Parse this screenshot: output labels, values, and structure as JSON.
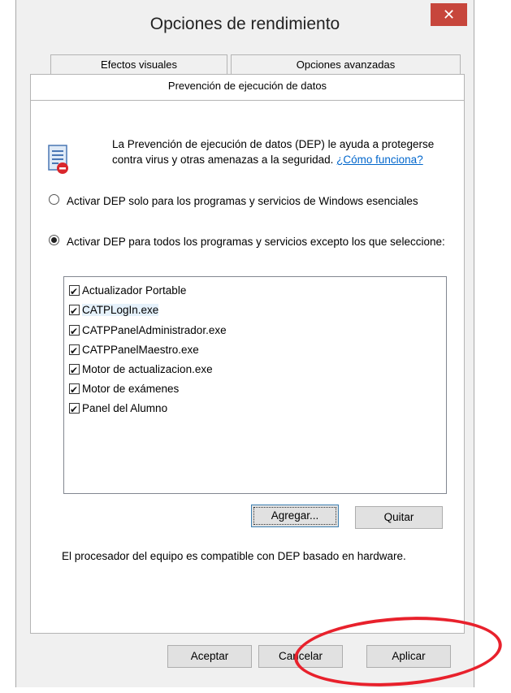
{
  "window": {
    "title": "Opciones de rendimiento",
    "close_symbol": "✕"
  },
  "tabs": [
    {
      "label": "Efectos visuales"
    },
    {
      "label": "Opciones avanzadas"
    },
    {
      "label": "Prevención de ejecución de datos"
    }
  ],
  "intro": {
    "text": "La Prevención de ejecución de datos (DEP) le ayuda a protegerse contra virus y otras amenazas a la seguridad. ",
    "link": "¿Cómo funciona?"
  },
  "options": [
    {
      "label": "Activar DEP solo para los programas y servicios de Windows esenciales",
      "selected": false
    },
    {
      "label": "Activar DEP para todos los programas y servicios excepto los que seleccione:",
      "selected": true
    }
  ],
  "programs": [
    {
      "label": "Actualizador Portable",
      "checked": true
    },
    {
      "label": "CATPLogIn.exe",
      "checked": true
    },
    {
      "label": "CATPPanelAdministrador.exe",
      "checked": true
    },
    {
      "label": "CATPPanelMaestro.exe",
      "checked": true
    },
    {
      "label": "Motor de actualizacion.exe",
      "checked": true
    },
    {
      "label": "Motor de exámenes",
      "checked": true
    },
    {
      "label": "Panel del Alumno",
      "checked": true
    }
  ],
  "buttons": {
    "add": "Agregar...",
    "remove": "Quitar",
    "ok": "Aceptar",
    "cancel": "Cancelar",
    "apply": "Aplicar"
  },
  "footer_note": "El procesador del equipo es compatible con DEP basado en hardware.",
  "colors": {
    "close_button": "#c7463c",
    "link": "#0066cc",
    "highlight": "#e8212c"
  }
}
